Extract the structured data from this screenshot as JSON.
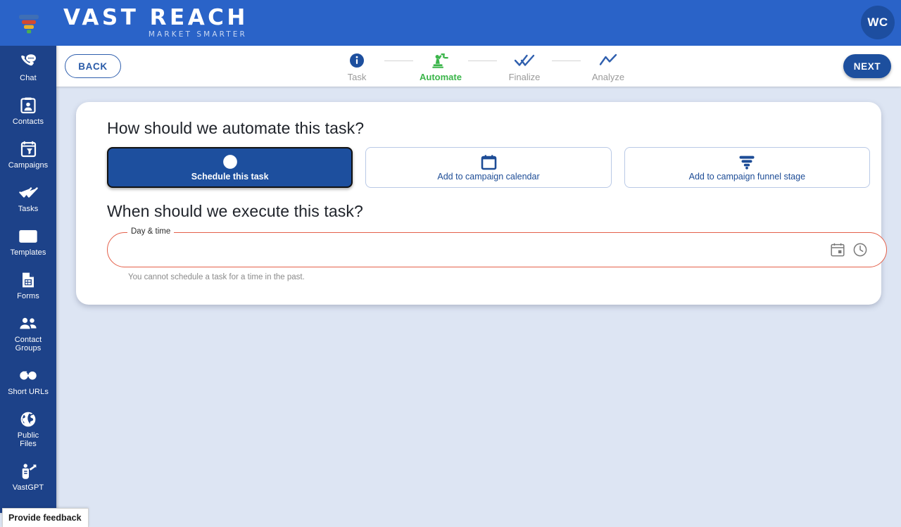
{
  "header": {
    "logo_icon": "funnel-logo-icon",
    "brand_name": "VAST REACH",
    "brand_tagline": "MARKET SMARTER",
    "avatar_initials": "WC"
  },
  "sidebar": {
    "items": [
      {
        "label": "Chat",
        "icon": "chat-bubble-phone-icon"
      },
      {
        "label": "Contacts",
        "icon": "contact-card-icon"
      },
      {
        "label": "Campaigns",
        "icon": "campaign-clipboard-icon"
      },
      {
        "label": "Tasks",
        "icon": "double-check-icon"
      },
      {
        "label": "Templates",
        "icon": "envelope-icon"
      },
      {
        "label": "Forms",
        "icon": "form-document-icon"
      },
      {
        "label": "Contact\nGroups",
        "label_line1": "Contact",
        "label_line2": "Groups",
        "icon": "people-group-icon"
      },
      {
        "label": "Short URLs",
        "icon": "link-chain-icon"
      },
      {
        "label": "Public\nFiles",
        "label_line1": "Public",
        "label_line2": "Files",
        "icon": "globe-icon"
      },
      {
        "label": "VastGPT",
        "icon": "vastgpt-robot-icon"
      }
    ]
  },
  "stepbar": {
    "back_label": "BACK",
    "next_label": "NEXT",
    "steps": [
      {
        "label": "Task",
        "icon": "info-circle-icon",
        "state": "done"
      },
      {
        "label": "Automate",
        "icon": "precision-manufacturing-icon",
        "state": "active"
      },
      {
        "label": "Finalize",
        "icon": "double-check-icon",
        "state": "upcoming"
      },
      {
        "label": "Analyze",
        "icon": "trend-line-icon",
        "state": "upcoming"
      }
    ],
    "active_color": "#3bb54a",
    "inactive_color": "#9a9a9a"
  },
  "main": {
    "question_automate": "How should we automate this task?",
    "question_schedule": "When should we execute this task?",
    "options": [
      {
        "label": "Schedule this task",
        "icon": "clock-icon",
        "selected": true
      },
      {
        "label": "Add to campaign calendar",
        "icon": "calendar-icon",
        "selected": false
      },
      {
        "label": "Add to campaign funnel stage",
        "icon": "funnel-icon",
        "selected": false
      }
    ],
    "day_time_field": {
      "legend": "Day & time",
      "value": "",
      "placeholder": "",
      "calendar_icon": "calendar-picker-icon",
      "clock_icon": "clock-picker-icon",
      "error_color": "#e4604a",
      "helper_text": "You cannot schedule a task for a time in the past."
    }
  },
  "footer": {
    "feedback_label": "Provide feedback"
  },
  "colors": {
    "header_blue": "#2a63c8",
    "sidebar_navy": "#1d4289",
    "page_background": "#dde5f3",
    "primary_blue": "#1d4f9e",
    "accent_green": "#3bb54a",
    "error_red": "#e4604a"
  }
}
